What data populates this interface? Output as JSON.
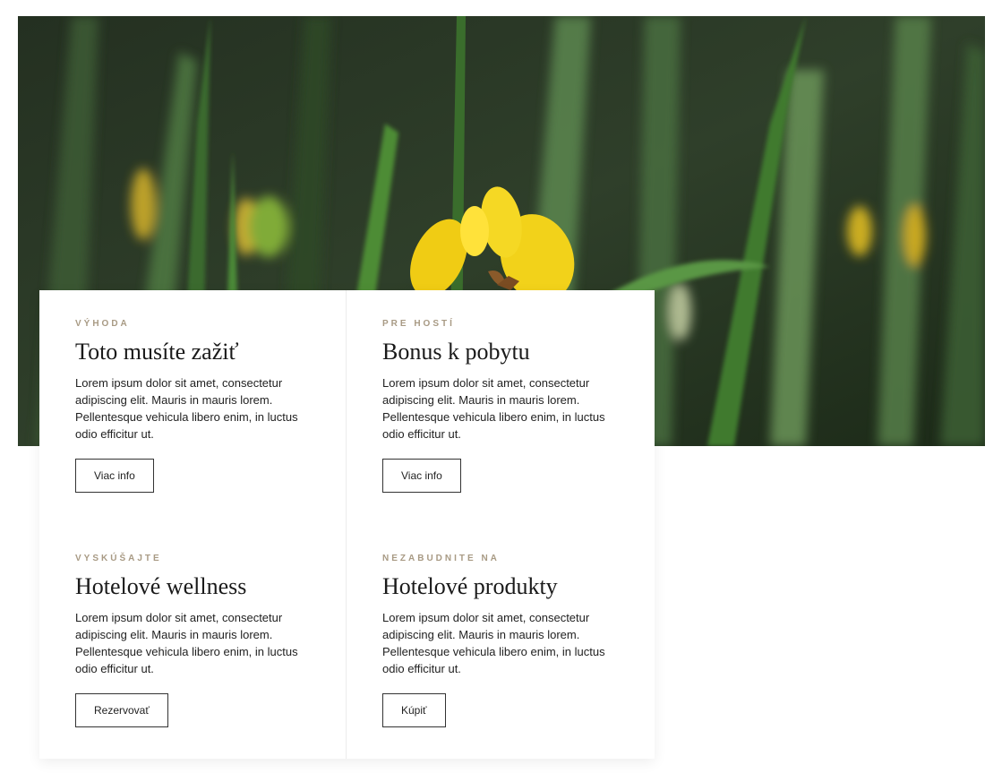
{
  "hero": {
    "image": "yellow-iris-flower-among-green-leaves"
  },
  "cards": [
    {
      "eyebrow": "VÝHODA",
      "title": "Toto musíte zažiť",
      "text": "Lorem ipsum dolor sit amet, consectetur adipiscing elit. Mauris in mauris lorem. Pellentesque vehicula libero enim, in luctus odio efficitur ut.",
      "button": "Viac info"
    },
    {
      "eyebrow": "PRE HOSTÍ",
      "title": "Bonus k pobytu",
      "text": "Lorem ipsum dolor sit amet, consectetur adipiscing elit. Mauris in mauris lorem. Pellentesque vehicula libero enim, in luctus odio efficitur ut.",
      "button": "Viac info"
    },
    {
      "eyebrow": "VYSKÚŠAJTE",
      "title": "Hotelové wellness",
      "text": "Lorem ipsum dolor sit amet, consectetur adipiscing elit. Mauris in mauris lorem. Pellentesque vehicula libero enim, in luctus odio efficitur ut.",
      "button": "Rezervovať"
    },
    {
      "eyebrow": "NEZABUDNITE NA",
      "title": "Hotelové produkty",
      "text": "Lorem ipsum dolor sit amet, consectetur adipiscing elit. Mauris in mauris lorem. Pellentesque vehicula libero enim, in luctus odio efficitur ut.",
      "button": "Kúpiť"
    }
  ],
  "colors": {
    "eyebrow": "#a89a84",
    "flower": "#f2d21a",
    "leaf": "#3f7a2e"
  }
}
